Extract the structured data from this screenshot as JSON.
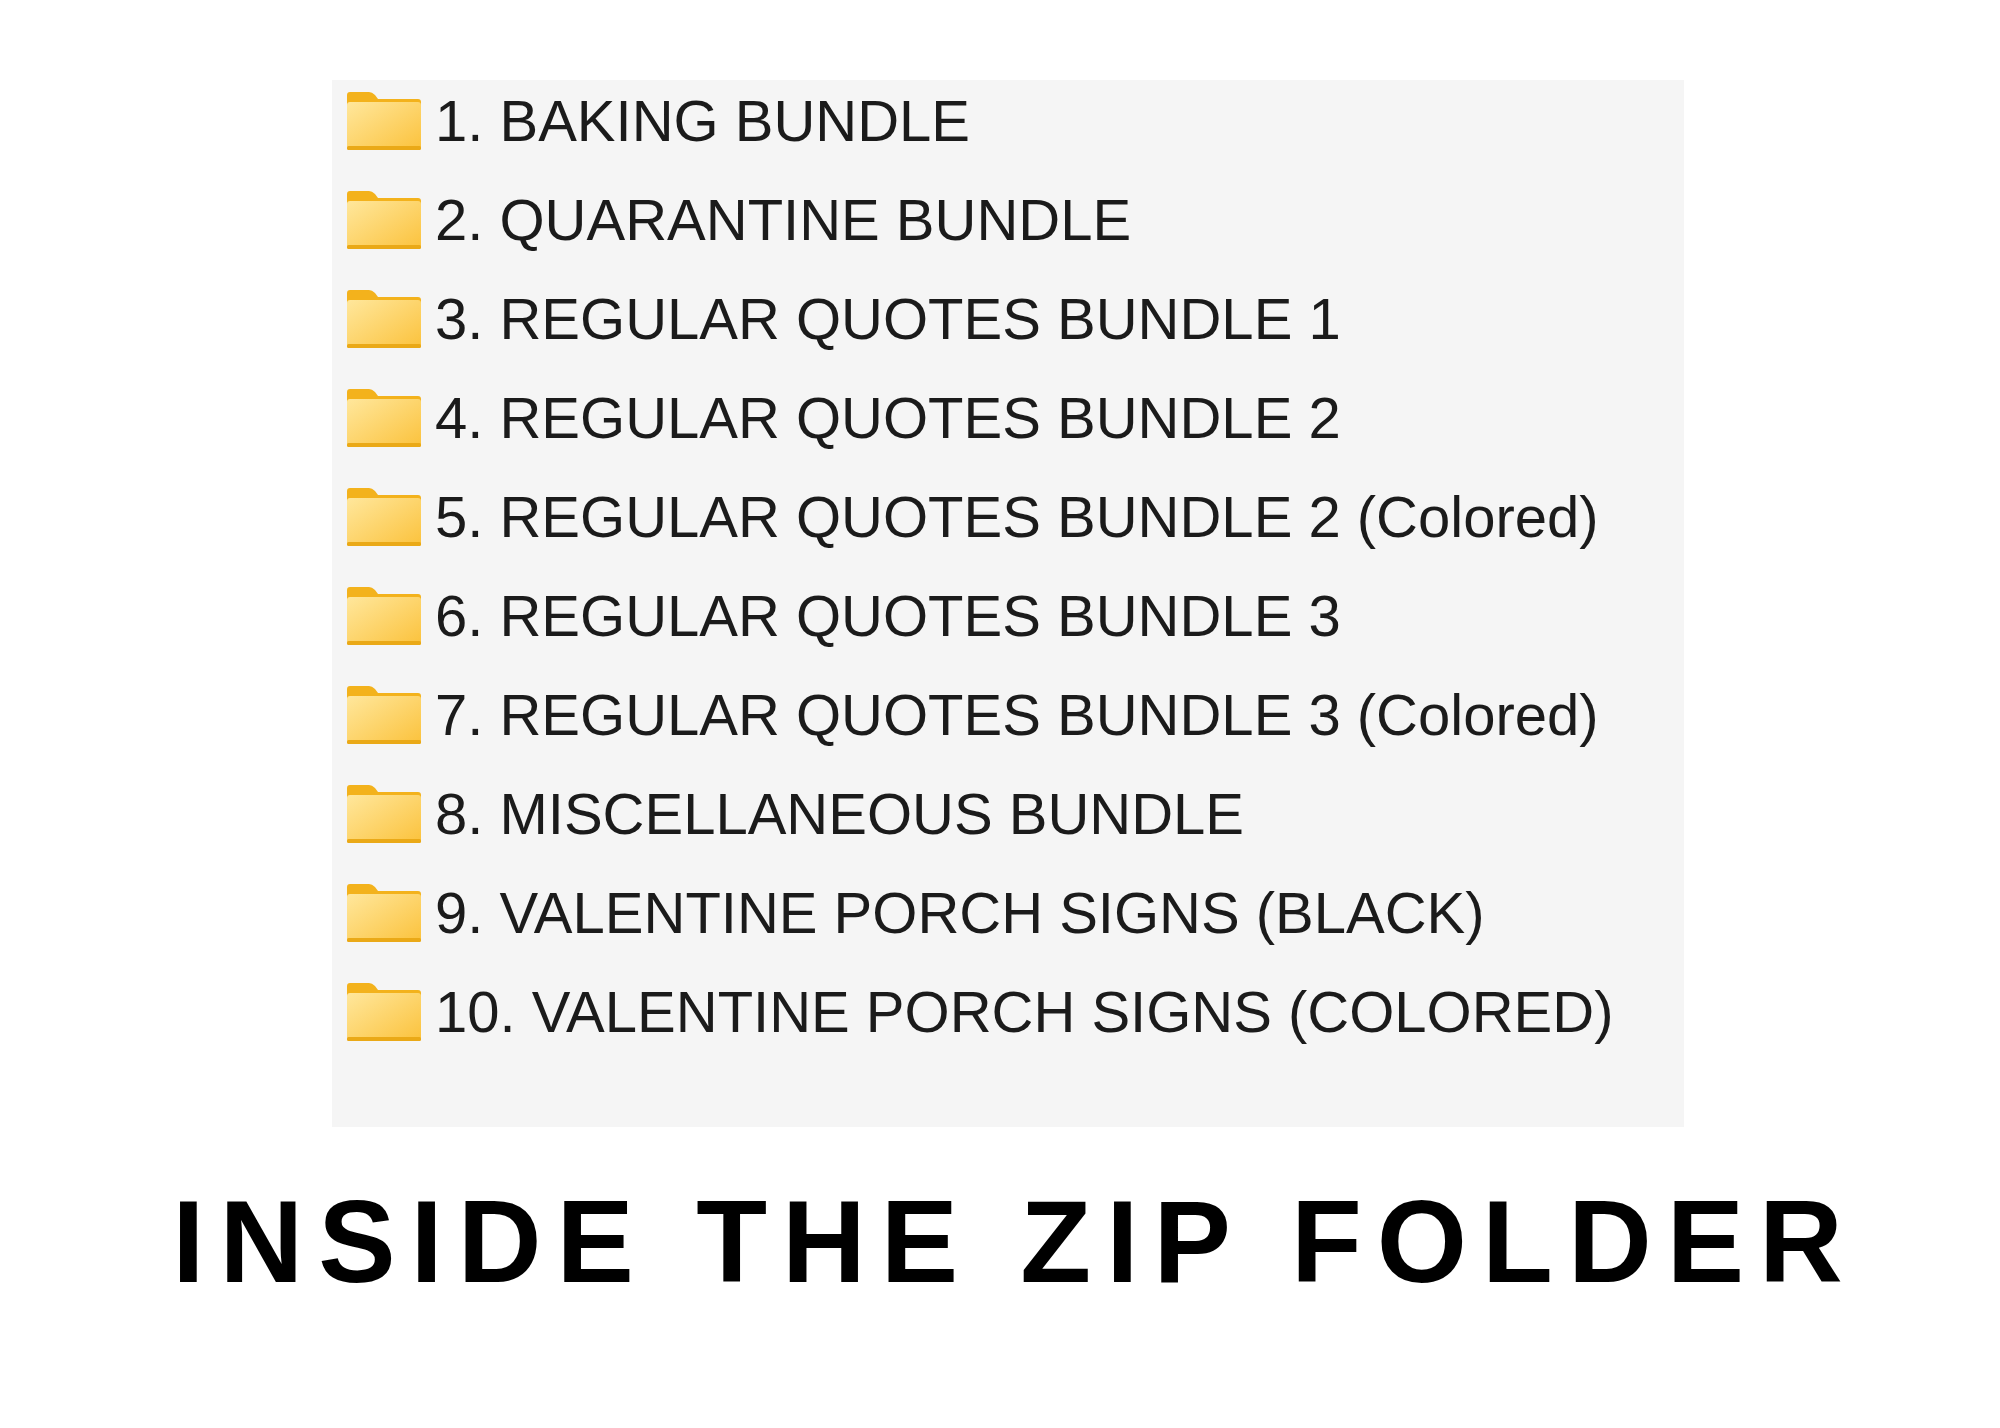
{
  "folder_list": {
    "items": [
      {
        "name": "1. BAKING BUNDLE"
      },
      {
        "name": "2. QUARANTINE BUNDLE"
      },
      {
        "name": "3. REGULAR QUOTES BUNDLE 1"
      },
      {
        "name": "4. REGULAR QUOTES BUNDLE 2"
      },
      {
        "name": "5. REGULAR QUOTES BUNDLE 2 (Colored)"
      },
      {
        "name": "6. REGULAR QUOTES BUNDLE 3"
      },
      {
        "name": "7. REGULAR QUOTES BUNDLE 3 (Colored)"
      },
      {
        "name": "8. MISCELLANEOUS BUNDLE"
      },
      {
        "name": "9. VALENTINE PORCH SIGNS (BLACK)"
      },
      {
        "name": "10. VALENTINE PORCH SIGNS (COLORED)"
      }
    ]
  },
  "caption": "INSIDE THE ZIP FOLDER"
}
